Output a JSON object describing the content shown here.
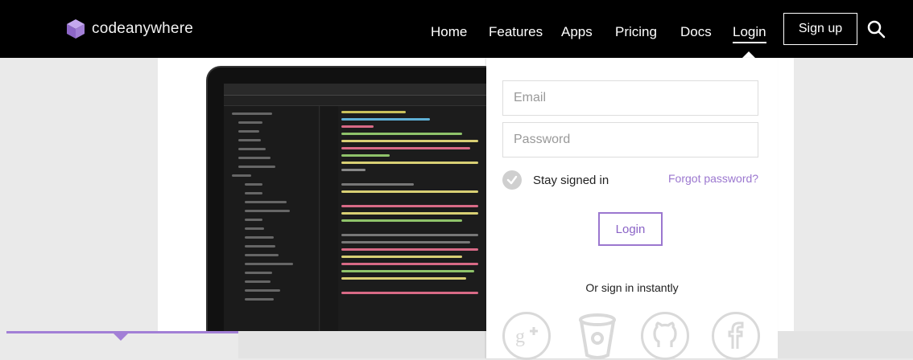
{
  "brand": {
    "name": "codeanywhere",
    "logo_icon": "codeanywhere-cube-icon",
    "logo_color": "#a27fd6"
  },
  "nav": {
    "items": [
      {
        "label": "Home"
      },
      {
        "label": "Features"
      },
      {
        "label": "Apps"
      },
      {
        "label": "Pricing"
      },
      {
        "label": "Docs"
      },
      {
        "label": "Login"
      }
    ],
    "signup_label": "Sign up",
    "search_icon": "search-icon"
  },
  "login_form": {
    "email_placeholder": "Email",
    "password_placeholder": "Password",
    "stay_signed_in_label": "Stay signed in",
    "forgot_password_label": "Forgot password?",
    "login_button_label": "Login",
    "alt_signin_label": "Or sign in instantly",
    "social_providers": [
      {
        "icon": "google-plus-icon"
      },
      {
        "icon": "bitbucket-icon"
      },
      {
        "icon": "github-icon"
      },
      {
        "icon": "facebook-icon"
      }
    ]
  },
  "colors": {
    "accent": "#9b77cf",
    "nav_bg": "#000000",
    "page_bg": "#eaeaea",
    "social_icon": "#d9d9d9"
  }
}
